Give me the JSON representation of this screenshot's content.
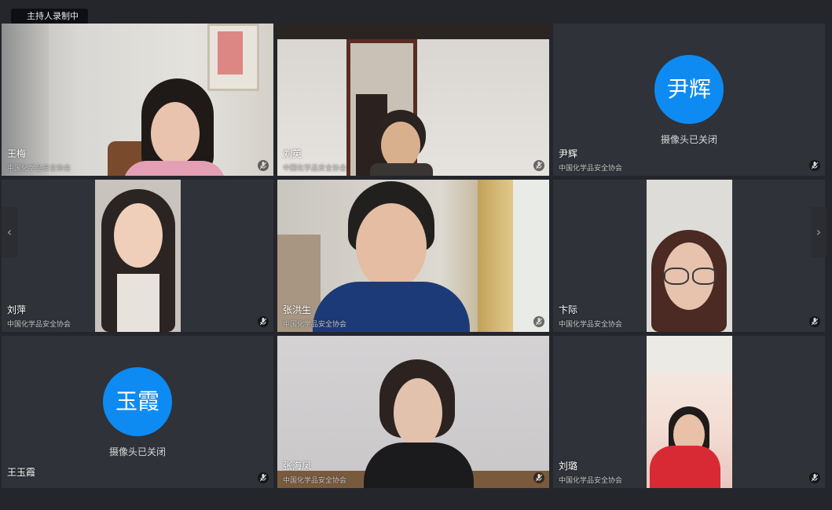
{
  "recording_badge": "主持人录制中",
  "nav": {
    "prev": "‹",
    "next": "›"
  },
  "participants": [
    {
      "name": "王梅",
      "org": "中国化学品安全协会",
      "camera_on": true
    },
    {
      "name": "刘英",
      "org": "中国化学品安全协会",
      "camera_on": true
    },
    {
      "name": "尹辉",
      "org": "中国化学品安全协会",
      "camera_on": false,
      "avatar_text": "尹辉",
      "camera_off_text": "摄像头已关闭"
    },
    {
      "name": "刘萍",
      "org": "中国化学品安全协会",
      "camera_on": true
    },
    {
      "name": "张洪生",
      "org": "中国化学品安全协会",
      "camera_on": true
    },
    {
      "name": "卞际",
      "org": "中国化学品安全协会",
      "camera_on": true
    },
    {
      "name": "王玉霞",
      "org": "",
      "camera_on": false,
      "avatar_text": "玉霞",
      "camera_off_text": "摄像头已关闭"
    },
    {
      "name": "张海凤",
      "org": "中国化学品安全协会",
      "camera_on": true
    },
    {
      "name": "刘璐",
      "org": "中国化学品安全协会",
      "camera_on": true
    }
  ],
  "colors": {
    "avatar_bg": "#0d8bf2",
    "tile_bg": "#2f3238",
    "page_bg": "#24262b"
  },
  "icons": {
    "mic": "microphone-muted-icon",
    "left": "chevron-left-icon",
    "right": "chevron-right-icon"
  }
}
